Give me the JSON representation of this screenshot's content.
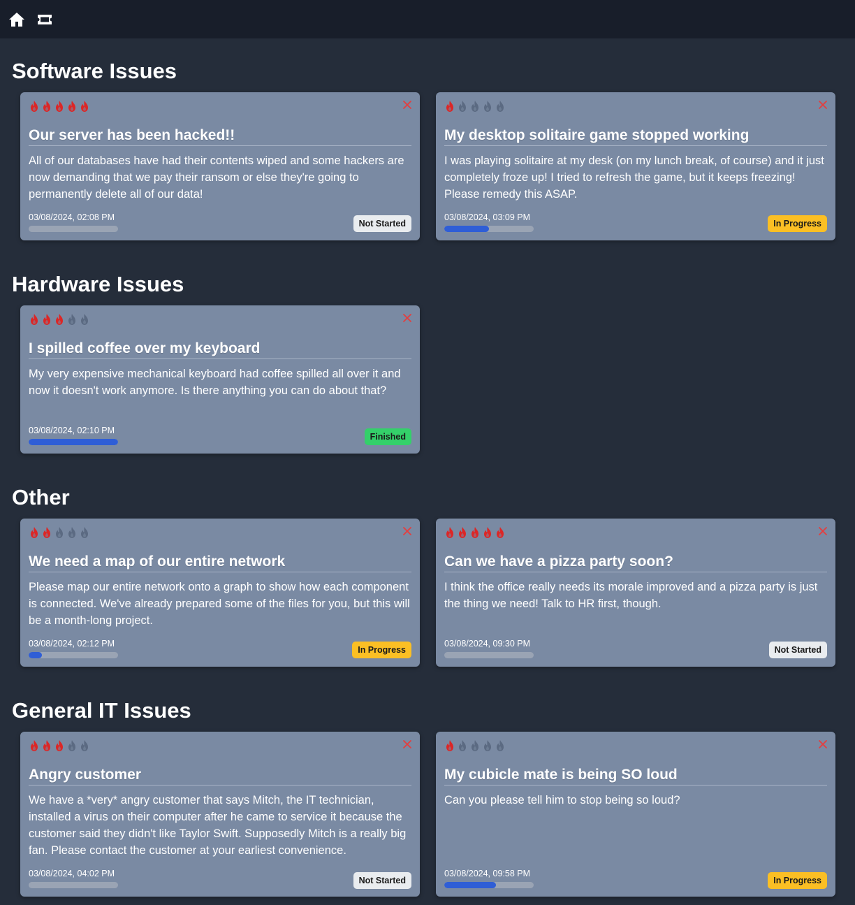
{
  "nav": {
    "items": [
      {
        "icon": "home-icon"
      },
      {
        "icon": "ticket-icon"
      }
    ]
  },
  "colors": {
    "background": "#252d3a",
    "topbar": "#181e2a",
    "card": "#7a8aa3",
    "flame_active": "#dc2626",
    "flame_inactive": "#5b6a82",
    "progress_fill": "#2f5ed6",
    "status_not_started": "#e9ecef",
    "status_in_progress": "#fbbf24",
    "status_finished": "#34d06a"
  },
  "sections": [
    {
      "title": "Software Issues",
      "tickets": [
        {
          "priority": 5,
          "title": "Our server has been hacked!!",
          "description": "All of our databases have had their contents wiped and some hackers are now demanding that we pay their ransom or else they're going to permanently delete all of our data!",
          "date": "03/08/2024, 02:08 PM",
          "progress": 0,
          "status": "Not Started"
        },
        {
          "priority": 1,
          "title": "My desktop solitaire game stopped working",
          "description": "I was playing solitaire at my desk (on my lunch break, of course) and it just completely froze up! I tried to refresh the game, but it keeps freezing! Please remedy this ASAP.",
          "date": "03/08/2024, 03:09 PM",
          "progress": 0.5,
          "status": "In Progress"
        }
      ]
    },
    {
      "title": "Hardware Issues",
      "tickets": [
        {
          "priority": 3,
          "title": "I spilled coffee over my keyboard",
          "description": "My very expensive mechanical keyboard had coffee spilled all over it and now it doesn't work anymore. Is there anything you can do about that?",
          "date": "03/08/2024, 02:10 PM",
          "progress": 1.0,
          "status": "Finished"
        }
      ]
    },
    {
      "title": "Other",
      "tickets": [
        {
          "priority": 2,
          "title": "We need a map of our entire network",
          "description": "Please map our entire network onto a graph to show how each component is connected. We've already prepared some of the files for you, but this will be a month-long project.",
          "date": "03/08/2024, 02:12 PM",
          "progress": 0.15,
          "status": "In Progress"
        },
        {
          "priority": 5,
          "title": "Can we have a pizza party soon?",
          "description": "I think the office really needs its morale improved and a pizza party is just the thing we need! Talk to HR first, though.",
          "date": "03/08/2024, 09:30 PM",
          "progress": 0,
          "status": "Not Started"
        }
      ]
    },
    {
      "title": "General IT Issues",
      "tickets": [
        {
          "priority": 3,
          "title": "Angry customer",
          "description": "We have a *very* angry customer that says Mitch, the IT technician, installed a virus on their computer after he came to service it because the customer said they didn't like Taylor Swift. Supposedly Mitch is a really big fan. Please contact the customer at your earliest convenience.",
          "date": "03/08/2024, 04:02 PM",
          "progress": 0,
          "status": "Not Started"
        },
        {
          "priority": 1,
          "title": "My cubicle mate is being SO loud",
          "description": "Can you please tell him to stop being so loud?",
          "date": "03/08/2024, 09:58 PM",
          "progress": 0.58,
          "status": "In Progress"
        }
      ]
    }
  ]
}
